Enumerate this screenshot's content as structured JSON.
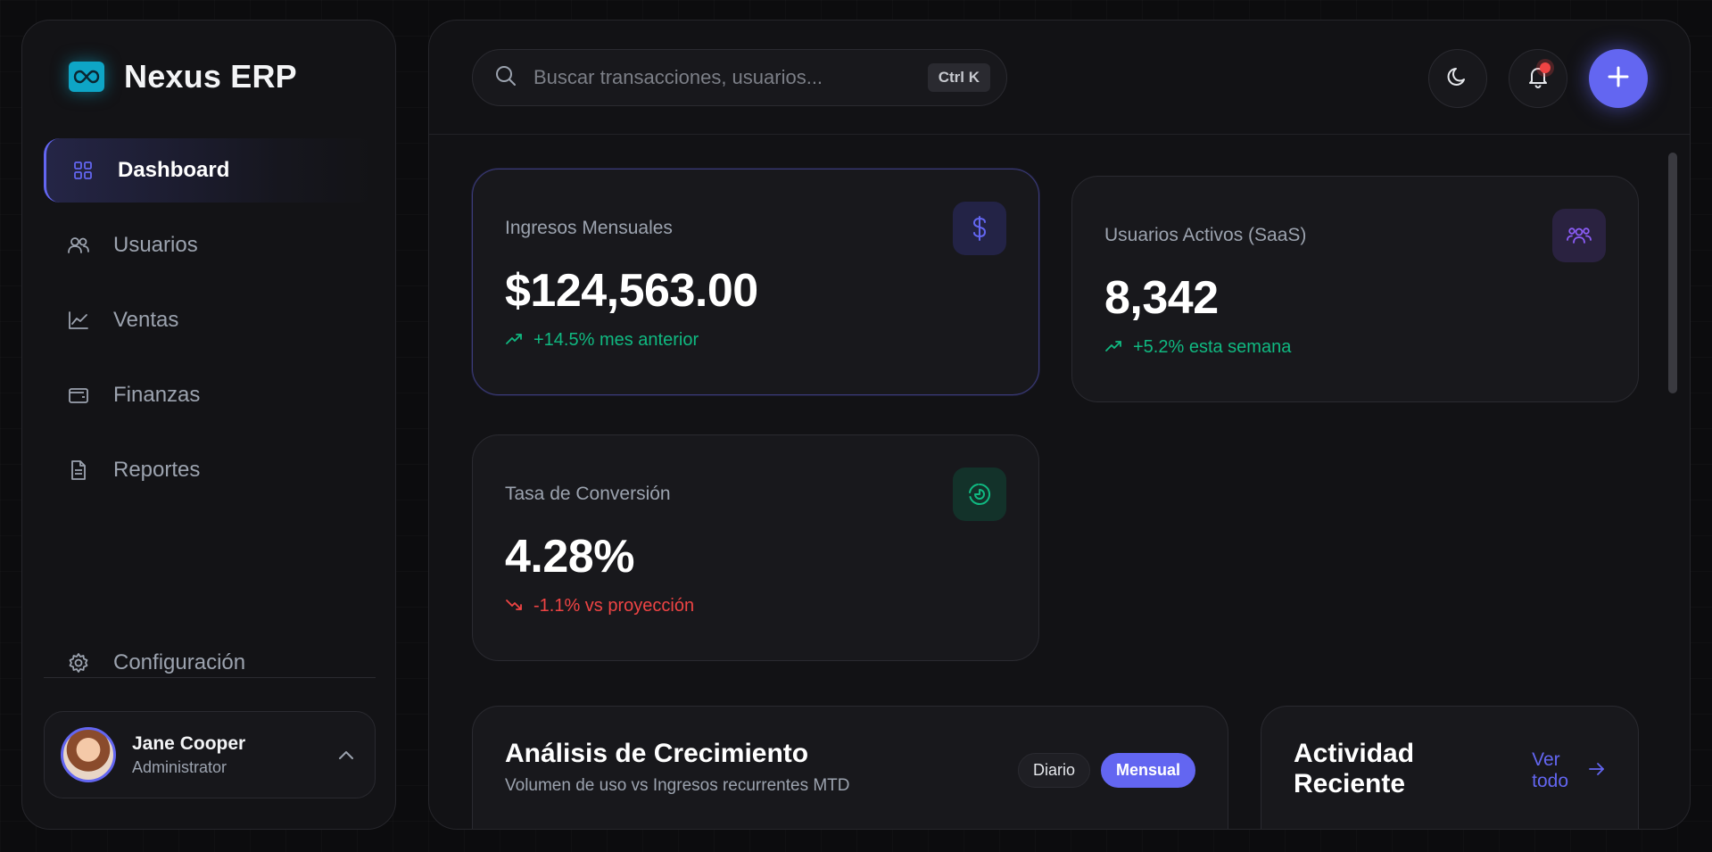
{
  "app": {
    "name": "Nexus ERP"
  },
  "sidebar": {
    "items": [
      {
        "label": "Dashboard",
        "icon": "grid-icon",
        "active": true
      },
      {
        "label": "Usuarios",
        "icon": "users-icon",
        "active": false
      },
      {
        "label": "Ventas",
        "icon": "trending-chart-icon",
        "active": false
      },
      {
        "label": "Finanzas",
        "icon": "wallet-icon",
        "active": false
      },
      {
        "label": "Reportes",
        "icon": "document-icon",
        "active": false
      }
    ],
    "settings_label": "Configuración"
  },
  "user": {
    "name": "Jane Cooper",
    "role": "Administrator"
  },
  "search": {
    "placeholder": "Buscar transacciones, usuarios...",
    "shortcut": "Ctrl K"
  },
  "notifications": {
    "has_unread": true
  },
  "stats": [
    {
      "title": "Ingresos Mensuales",
      "value": "$124,563.00",
      "change": "+14.5% mes anterior",
      "trend": "up",
      "icon": "dollar-icon",
      "icon_color": "#6366f1"
    },
    {
      "title": "Usuarios Activos (SaaS)",
      "value": "8,342",
      "change": "+5.2% esta semana",
      "trend": "up",
      "icon": "users-group-icon",
      "icon_color": "#8b5cf6"
    },
    {
      "title": "Tasa de Conversión",
      "value": "4.28%",
      "change": "-1.1% vs proyección",
      "trend": "down",
      "icon": "pie-chart-icon",
      "icon_color": "#10b981"
    }
  ],
  "growth": {
    "title": "Análisis de Crecimiento",
    "subtitle": "Volumen de uso vs Ingresos recurrentes MTD",
    "toggles": [
      {
        "label": "Diario",
        "active": false
      },
      {
        "label": "Mensual",
        "active": true
      }
    ]
  },
  "activity": {
    "title_line1": "Actividad",
    "title_line2": "Reciente",
    "link_line1": "Ver",
    "link_line2": "todo"
  },
  "colors": {
    "accent": "#6366f1",
    "success": "#10b981",
    "danger": "#ef4444",
    "brand": "#0ea5c6"
  }
}
